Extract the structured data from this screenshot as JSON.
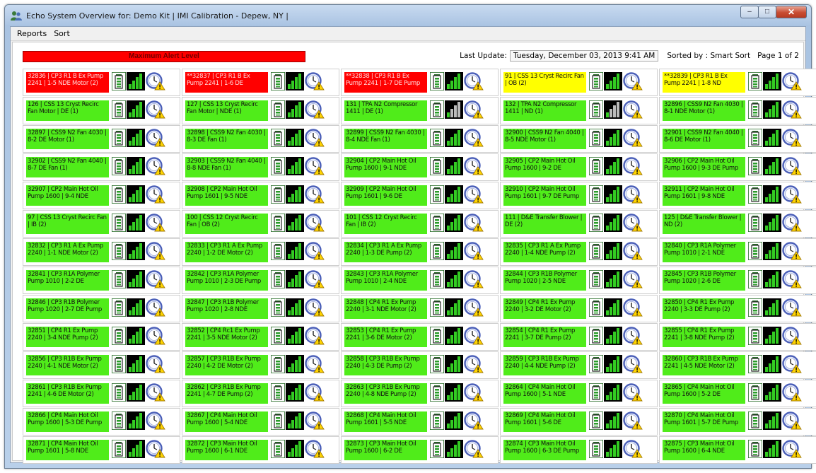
{
  "window": {
    "title": "Echo System Overview for: Demo Kit | IMI Calibration - Depew, NY |",
    "controls": [
      "minimize",
      "maximize",
      "close"
    ]
  },
  "menu": {
    "items": [
      "Reports",
      "Sort"
    ]
  },
  "status": {
    "alert_text": "Maximum Alert Level",
    "alert_color": "#ff0000",
    "last_update_label": "Last Update:",
    "last_update_value": "Tuesday, December 03, 2013 9:41 AM",
    "sorted_label": "Sorted by : Smart Sort",
    "page_label": "Page 1 of 2"
  },
  "colors": {
    "ok": "#50ec1a",
    "alarm": "#ff0000",
    "warning": "#ffff00"
  },
  "tiles": [
    {
      "label": "32836 | CP3 R1 B Ex Pump 2241 | 1-5 NDE Motor (2)",
      "status": "red",
      "signal": "full"
    },
    {
      "label": "**32837 | CP3 R1 B Ex Pump 2241 | 1-6 DE",
      "status": "red",
      "signal": "full"
    },
    {
      "label": "**32838 | CP3 R1 B Ex Pump 2241 | 1-7 DE Pump",
      "status": "red",
      "signal": "full"
    },
    {
      "label": "91 | CSS 13 Cryst Recirc Fan | OB (2)",
      "status": "yellow",
      "signal": "full"
    },
    {
      "label": "**32839 | CP3 R1 B Ex Pump 2241 | 1-8 ND",
      "status": "yellow",
      "signal": "full"
    },
    {
      "label": "126 | CSS 13 Cryst Recirc Fan Motor | DE (1)",
      "status": "green",
      "signal": "full"
    },
    {
      "label": "127 | CSS 13 Cryst Recirc Fan Motor | NDE (1)",
      "status": "green",
      "signal": "full"
    },
    {
      "label": "131 | TPA N2 Compressor 1411 | DE (1)",
      "status": "green",
      "signal": "weak"
    },
    {
      "label": "132 | TPA N2 Compressor 1411 | ND (1)",
      "status": "green",
      "signal": "weak"
    },
    {
      "label": "32896 | CSS9 N2 Fan 4030 | 8-1 NDE Motor (1)",
      "status": "green",
      "signal": "full"
    },
    {
      "label": "32897 | CSS9 N2 Fan 4030 | 8-2 DE Motor (1)",
      "status": "green",
      "signal": "full"
    },
    {
      "label": "32898 | CSS9 N2 Fan 4030 | 8-3 DE Fan (1)",
      "status": "green",
      "signal": "full"
    },
    {
      "label": "32899 | CSS9 N2 Fan 4030 | 8-4 NDE Fan (1)",
      "status": "green",
      "signal": "full"
    },
    {
      "label": "32900 | CSS9 N2 Fan 4040 | 8-5 NDE Motor (1)",
      "status": "green",
      "signal": "full"
    },
    {
      "label": "32901 | CSS9 N2 Fan 4040 | 8-6 DE Motor (1)",
      "status": "green",
      "signal": "full"
    },
    {
      "label": "32902 | CSS9 N2 Fan 4040 | 8-7 DE Fan (1)",
      "status": "green",
      "signal": "full"
    },
    {
      "label": "32903 | CSS9 N2 Fan 4040 | 8-8 NDE Fan (1)",
      "status": "green",
      "signal": "full"
    },
    {
      "label": "32904 | CP2 Main Hot Oil Pump 1600 | 9-1 NDE",
      "status": "green",
      "signal": "full"
    },
    {
      "label": "32905 | CP2 Main Hot Oil Pump 1600 | 9-2 DE",
      "status": "green",
      "signal": "full"
    },
    {
      "label": "32906 | CP2 Main Hot Oil Pump 1600 | 9-3 DE Pump",
      "status": "green",
      "signal": "full"
    },
    {
      "label": "32907 | CP2 Main Hot Oil Pump 1600 | 9-4 NDE",
      "status": "green",
      "signal": "full"
    },
    {
      "label": "32908 | CP2 Main Hot Oil Pump 1601 | 9-5 NDE",
      "status": "green",
      "signal": "full"
    },
    {
      "label": "32909 | CP2 Main Hot Oil Pump 1601 | 9-6 DE",
      "status": "green",
      "signal": "full"
    },
    {
      "label": "32910 | CP2 Main Hot Oil Pump 1601 | 9-7 DE Pump",
      "status": "green",
      "signal": "full"
    },
    {
      "label": "32911 | CP2 Main Hot Oil Pump 1601 | 9-8 NDE",
      "status": "green",
      "signal": "full"
    },
    {
      "label": "97 | CSS 13 Cryst Recirc Fan | IB (2)",
      "status": "green",
      "signal": "full"
    },
    {
      "label": "100 | CSS 12 Cryst Recirc Fan | OB (2)",
      "status": "green",
      "signal": "full"
    },
    {
      "label": "101 | CSS 12 Cryst Recirc Fan | IB (2)",
      "status": "green",
      "signal": "full"
    },
    {
      "label": "111 | D&E Transfer Blower | DE (2)",
      "status": "green",
      "signal": "full"
    },
    {
      "label": "125 | D&E Transfer Blower | ND (2)",
      "status": "green",
      "signal": "full"
    },
    {
      "label": "32832 | CP3 R1 A Ex Pump 2240 | 1-1 NDE Motor (2)",
      "status": "green",
      "signal": "full"
    },
    {
      "label": "32833 | CP3 R1 A Ex Pump 2240 | 1-2 DE Motor (2)",
      "status": "green",
      "signal": "full"
    },
    {
      "label": "32834 | CP3 R1 A Ex Pump 2240 | 1-3 DE Pump (2)",
      "status": "green",
      "signal": "full"
    },
    {
      "label": "32835 | CP3 R1 A Ex Pump 2240 | 1-4 NDE Pump (2)",
      "status": "green",
      "signal": "full"
    },
    {
      "label": "32840 | CP3 R1A Polymer Pump 1010 | 2-1 NDE",
      "status": "green",
      "signal": "full"
    },
    {
      "label": "32841 | CP3 R1A Polymer Pump 1010 | 2-2 DE",
      "status": "green",
      "signal": "full"
    },
    {
      "label": "32842 | CP3 R1A Polymer Pump 1010 | 2-3 DE Pump",
      "status": "green",
      "signal": "full"
    },
    {
      "label": "32843 | CP3 R1A Polymer Pump 1010 | 2-4 NDE",
      "status": "green",
      "signal": "full"
    },
    {
      "label": "32844 | CP3 R1B Polymer Pump 1020 | 2-5 NDE",
      "status": "green",
      "signal": "full"
    },
    {
      "label": "32845 | CP3 R1B Polymer Pump 1020 | 2-6 DE",
      "status": "green",
      "signal": "full"
    },
    {
      "label": "32846 | CP3 R1B Polymer Pump 1020 | 2-7 DE Pump",
      "status": "green",
      "signal": "full"
    },
    {
      "label": "32847 | CP3 R1B Polymer Pump 1020 | 2-8 NDE",
      "status": "green",
      "signal": "full"
    },
    {
      "label": "32848 | CP4 R1 Ex Pump 2240 | 3-1 NDE Motor (2)",
      "status": "green",
      "signal": "full"
    },
    {
      "label": "32849 | CP4 R1 Ex Pump 2240 | 3-2 DE Motor (2)",
      "status": "green",
      "signal": "full"
    },
    {
      "label": "32850 | CP4 R1 Ex Pump 2240 | 3-3 DE Pump (2)",
      "status": "green",
      "signal": "full"
    },
    {
      "label": "32851 | CP4 R1 Ex Pump 2240 | 3-4 NDE Pump (2)",
      "status": "green",
      "signal": "full"
    },
    {
      "label": "32852 | CP4 Rc1 Ex Pump 2241 | 3-5 NDE Motor (2)",
      "status": "green",
      "signal": "full"
    },
    {
      "label": "32853 | CP4 R1 Ex Pump 2241 | 3-6 DE Motor (2)",
      "status": "green",
      "signal": "full"
    },
    {
      "label": "32854 | CP4 R1 Ex Pump 2241 | 3-7 DE Pump (2)",
      "status": "green",
      "signal": "full"
    },
    {
      "label": "32855 | CP4 R1 Ex Pump 2241 | 3-8 NDE Pump (2)",
      "status": "green",
      "signal": "full"
    },
    {
      "label": "32856 | CP3 R1B Ex Pump 2240 | 4-1 NDE Motor (2)",
      "status": "green",
      "signal": "full"
    },
    {
      "label": "32857 | CP3 R1B Ex Pump 2240 | 4-2 DE Motor (2)",
      "status": "green",
      "signal": "full"
    },
    {
      "label": "32858 | CP3 R1B Ex Pump 2240 | 4-3 DE Pump (2)",
      "status": "green",
      "signal": "full"
    },
    {
      "label": "32859 | CP3 R1B Ex Pump 2240 | 4-4 NDE Pump (2)",
      "status": "green",
      "signal": "full"
    },
    {
      "label": "32860 | CP3 R1B Ex Pump 2241 | 4-5 NDE Motor (2)",
      "status": "green",
      "signal": "full"
    },
    {
      "label": "32861 | CP3 R1B Ex Pump 2241 | 4-6 DE Motor (2)",
      "status": "green",
      "signal": "full"
    },
    {
      "label": "32862 | CP3 R1B Ex Pump 2241 | 4-7 DE Pump (2)",
      "status": "green",
      "signal": "full"
    },
    {
      "label": "32863 | CP3 R1B Ex Pump 2240 | 4-8 NDE Pump (2)",
      "status": "green",
      "signal": "full"
    },
    {
      "label": "32864 | CP4 Main Hot Oil Pump 1600 | 5-1 NDE",
      "status": "green",
      "signal": "full"
    },
    {
      "label": "32865 | CP4 Main Hot Oil Pump 1600 | 5-2 DE",
      "status": "green",
      "signal": "full"
    },
    {
      "label": "32866 | CP4 Main Hot Oil Pump 1600 | 5-3 DE Pump",
      "status": "green",
      "signal": "full"
    },
    {
      "label": "32867 | CP4 Main Hot Oil Pump 1600 | 5-4 NDE",
      "status": "green",
      "signal": "full"
    },
    {
      "label": "32868 | CP4 Main Hot Oil Pump 1601 | 5-5 NDE",
      "status": "green",
      "signal": "full"
    },
    {
      "label": "32869 | CP4 Main Hot Oil Pump 1601 | 5-6 DE",
      "status": "green",
      "signal": "full"
    },
    {
      "label": "32870 | CP4 Main Hot Oil Pump 1601 | 5-7 DE Pump",
      "status": "green",
      "signal": "full"
    },
    {
      "label": "32871 | CP4 Main Hot Oil Pump 1601 | 5-8 NDE",
      "status": "green",
      "signal": "full"
    },
    {
      "label": "32872 | CP3 Main Hot Oil Pump 1600 | 6-1 NDE",
      "status": "green",
      "signal": "full"
    },
    {
      "label": "32873 | CP3 Main Hot Oil Pump 1600 | 6-2 DE",
      "status": "green",
      "signal": "full"
    },
    {
      "label": "32874 | CP3 Main Hot Oil Pump 1600 | 6-3 DE Pump",
      "status": "green",
      "signal": "full"
    },
    {
      "label": "32875 | CP3 Main Hot Oil Pump 1600 | 6-4 NDE",
      "status": "green",
      "signal": "full"
    }
  ],
  "tile_icons": [
    "battery-icon",
    "signal-strength-icon",
    "clock-warning-icon"
  ]
}
